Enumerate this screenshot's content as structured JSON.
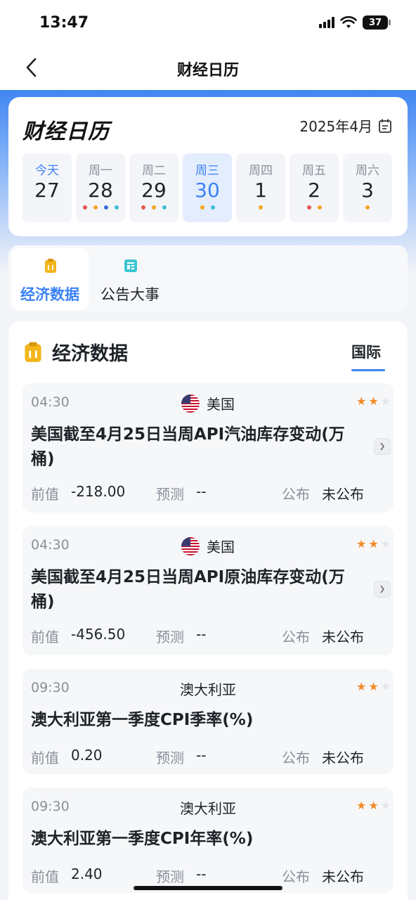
{
  "status_bar": {
    "time": "13:47",
    "battery": "37"
  },
  "nav": {
    "title": "财经日历"
  },
  "calendar": {
    "brand": "财经日历",
    "month": "2025年4月",
    "days": [
      {
        "weekday": "今天",
        "date": "27",
        "dots": []
      },
      {
        "weekday": "周一",
        "date": "28",
        "dots": [
          "#e8564f",
          "#f5a623",
          "#3b6fd8",
          "#3fbfd9"
        ]
      },
      {
        "weekday": "周二",
        "date": "29",
        "dots": [
          "#e8564f",
          "#f5a623",
          "#3fbfd9"
        ]
      },
      {
        "weekday": "周三",
        "date": "30",
        "dots": [
          "#f5a623",
          "#3fbfd9"
        ]
      },
      {
        "weekday": "周四",
        "date": "1",
        "dots": [
          "#f5a623"
        ]
      },
      {
        "weekday": "周五",
        "date": "2",
        "dots": [
          "#e8564f",
          "#f5a623"
        ]
      },
      {
        "weekday": "周六",
        "date": "3",
        "dots": [
          "#f5a623"
        ]
      }
    ]
  },
  "tabs": [
    {
      "label": "经济数据"
    },
    {
      "label": "公告大事"
    }
  ],
  "section": {
    "title": "经济数据",
    "region_tab": "国际"
  },
  "events": [
    {
      "time": "04:30",
      "country": "美国",
      "stars": 2,
      "name": "美国截至4月25日当周API汽油库存变动(万桶)",
      "prev_label": "前值",
      "prev": "-218.00",
      "forecast_label": "预测",
      "forecast": "--",
      "publish_label": "公布",
      "publish": "未公布"
    },
    {
      "time": "04:30",
      "country": "美国",
      "stars": 2,
      "name": "美国截至4月25日当周API原油库存变动(万桶)",
      "prev_label": "前值",
      "prev": "-456.50",
      "forecast_label": "预测",
      "forecast": "--",
      "publish_label": "公布",
      "publish": "未公布"
    },
    {
      "time": "09:30",
      "country": "澳大利亚",
      "stars": 2,
      "name": "澳大利亚第一季度CPI季率(%)",
      "prev_label": "前值",
      "prev": "0.20",
      "forecast_label": "预测",
      "forecast": "--",
      "publish_label": "公布",
      "publish": "未公布"
    },
    {
      "time": "09:30",
      "country": "澳大利亚",
      "stars": 2,
      "name": "澳大利亚第一季度CPI年率(%)",
      "prev_label": "前值",
      "prev": "2.40",
      "forecast_label": "预测",
      "forecast": "--",
      "publish_label": "公布",
      "publish": "未公布"
    }
  ],
  "colors": {
    "accent": "#3b82f6",
    "star_on": "#f08a24",
    "star_off": "#e3e5e9"
  }
}
